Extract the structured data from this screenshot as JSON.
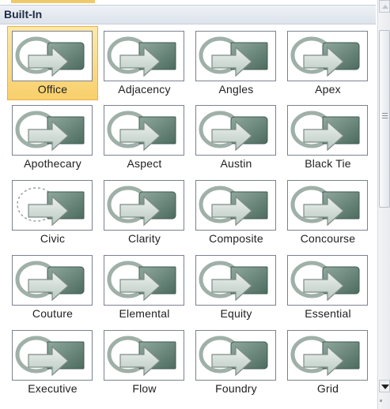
{
  "gallery": {
    "section_title": "Built-In",
    "selected_index": 0,
    "items": [
      {
        "label": "Office"
      },
      {
        "label": "Adjacency"
      },
      {
        "label": "Angles"
      },
      {
        "label": "Apex"
      },
      {
        "label": "Apothecary"
      },
      {
        "label": "Aspect"
      },
      {
        "label": "Austin"
      },
      {
        "label": "Black Tie"
      },
      {
        "label": "Civic"
      },
      {
        "label": "Clarity"
      },
      {
        "label": "Composite"
      },
      {
        "label": "Concourse"
      },
      {
        "label": "Couture"
      },
      {
        "label": "Elemental"
      },
      {
        "label": "Equity"
      },
      {
        "label": "Essential"
      },
      {
        "label": "Executive"
      },
      {
        "label": "Flow"
      },
      {
        "label": "Foundry"
      },
      {
        "label": "Grid"
      }
    ]
  },
  "scrollbar": {
    "up_icon": "scroll-up-arrow-icon",
    "down_icon": "scroll-down-arrow-icon",
    "grip_icon": "scrollbar-grip-icon"
  },
  "colors": {
    "header_bg": "#dde3ec",
    "selection": "#f8cf6b",
    "shape_dark": "#4d6b5f",
    "shape_light": "#b8c8c0",
    "thumb_border": "#7a8290"
  }
}
